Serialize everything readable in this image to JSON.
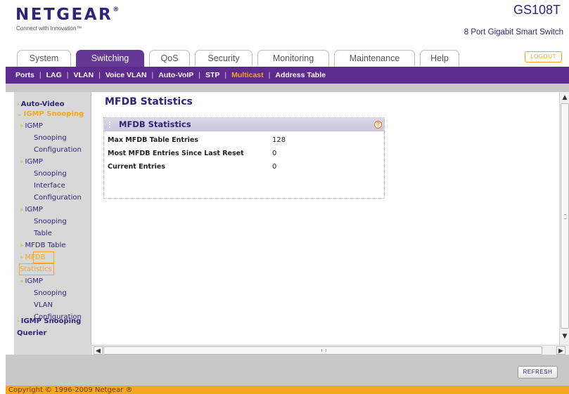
{
  "brand": {
    "logo_text": "NETGEAR",
    "tagline": "Connect with Innovation™",
    "model": "GS108T",
    "model_description": "8 Port Gigabit Smart Switch"
  },
  "tabs": [
    {
      "label": "System"
    },
    {
      "label": "Switching"
    },
    {
      "label": "QoS"
    },
    {
      "label": "Security"
    },
    {
      "label": "Monitoring"
    },
    {
      "label": "Maintenance"
    },
    {
      "label": "Help"
    }
  ],
  "active_tab": "Switching",
  "logout_label": "LOGOUT",
  "subnav": [
    {
      "label": "Ports"
    },
    {
      "label": "LAG"
    },
    {
      "label": "VLAN"
    },
    {
      "label": "Voice VLAN"
    },
    {
      "label": "Auto-VoIP"
    },
    {
      "label": "STP"
    },
    {
      "label": "Multicast"
    },
    {
      "label": "Address Table"
    }
  ],
  "active_subnav": "Multicast",
  "leftnav": {
    "auto_video": "Auto-Video",
    "igmp_snooping": "IGMP Snooping",
    "sub_items": [
      {
        "lines": [
          "IGMP",
          "Snooping",
          "Configuration"
        ]
      },
      {
        "lines": [
          "IGMP",
          "Snooping",
          "Interface",
          "Configuration"
        ]
      },
      {
        "lines": [
          "IGMP",
          "Snooping",
          "Table"
        ]
      },
      {
        "lines": [
          "MFDB Table"
        ]
      },
      {
        "lines": [
          "MFDB",
          "Statistics"
        ]
      },
      {
        "lines": [
          "IGMP",
          "Snooping",
          "VLAN",
          "Configuration"
        ]
      }
    ],
    "querier_line1": "IGMP Snooping",
    "querier_line2": "Querier"
  },
  "page_title": "MFDB Statistics",
  "panel": {
    "title": "MFDB Statistics",
    "help_glyph": "?",
    "rows": [
      {
        "label": "Max MFDB Table Entries",
        "value": "128"
      },
      {
        "label": "Most MFDB Entries Since Last Reset",
        "value": "0"
      },
      {
        "label": "Current Entries",
        "value": "0"
      }
    ]
  },
  "refresh_label": "REFRESH",
  "copyright": "Copyright © 1996-2009 Netgear ®"
}
